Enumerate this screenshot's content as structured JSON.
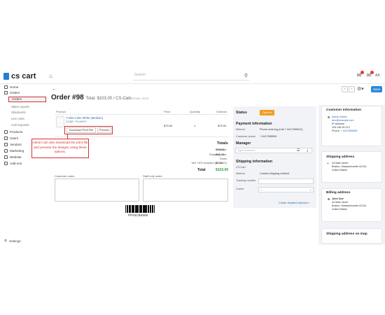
{
  "header": {
    "logo": "cs cart",
    "search_placeholder": "Search",
    "user_initials": "AA"
  },
  "sidebar": {
    "items": [
      {
        "label": "Home"
      },
      {
        "label": "Orders"
      },
      {
        "label": "Products"
      },
      {
        "label": "Users"
      },
      {
        "label": "Vendors"
      },
      {
        "label": "Marketing"
      },
      {
        "label": "Website"
      },
      {
        "label": "Add-ons"
      }
    ],
    "orders_sub": [
      "Orders",
      "Sales reports",
      "Shipments",
      "Live carts",
      "Call requests"
    ],
    "settings": "Settings"
  },
  "order": {
    "title": "Order #98",
    "subtitle": "Total: $103.00 / CS-Cart",
    "date": "/ 01/05/2026, 09:20"
  },
  "product_table": {
    "headers": [
      "Product",
      "Price",
      "Quantity",
      "Subtotal"
    ],
    "row": {
      "name": "T-shirt Colin White (Medium)",
      "code": "CODE: TS-WHT1",
      "price": "$75.00",
      "qty": "1",
      "subtotal": "$75.00"
    },
    "download_btn": "Download Print File",
    "preview_btn": "Preview"
  },
  "callout": {
    "text": "Admin can also download the print file and preview the designs using these options."
  },
  "totals": {
    "title": "Totals",
    "rows": [
      {
        "label": "Subtotal:",
        "value": "$75.00"
      },
      {
        "label": "Shipping cost:",
        "value": "$28.00"
      },
      {
        "label": "Taxes",
        "value": ""
      },
      {
        "label": "VAT 10% included ($244.42)",
        "value": "$2.55"
      }
    ],
    "grand_label": "Total",
    "grand_value": "$103.00"
  },
  "notes": {
    "customer": "Customer notes",
    "staff": "Staff only notes"
  },
  "barcode_text": "PP45CB9998",
  "status_panel": {
    "status_title": "Status",
    "status_value": "Open",
    "payment_title": "Payment information",
    "method_label": "Method",
    "method_value": "Phone ordering (Call + 5417555012)",
    "phone_label": "Customer phone",
    "phone_value": "+ 5417555555",
    "manager_title": "Manager",
    "manager_placeholder": "Type to search...",
    "shipping_title": "Shipping information",
    "ship_carrier_sub": "CS-Cart",
    "ship_method_label": "Method",
    "ship_method_value": "Custom shipping method",
    "tracking_label": "Tracking number",
    "carrier_label": "Carrier",
    "carrier_value": "--",
    "create_link": "Create detailed shipment"
  },
  "right_col": {
    "customer_title": "Customer information",
    "customer_name": "Admin Admin",
    "customer_email": "dev@example.com",
    "ip_label": "IP address:",
    "ip_value": "153.148.26.213",
    "phone_label": "Phone:",
    "phone_value": "+ 5417555555",
    "shipping_title": "Shipping address",
    "ship_lines": [
      "44 Main street",
      "Boston, Massachusetts 02134",
      "United States"
    ],
    "billing_title": "Billing address",
    "bill_name": "John Doe",
    "bill_lines": [
      "44 Main street",
      "Boston, Massachusetts 02134",
      "United States"
    ],
    "shipping_map_title": "Shipping address on map"
  }
}
